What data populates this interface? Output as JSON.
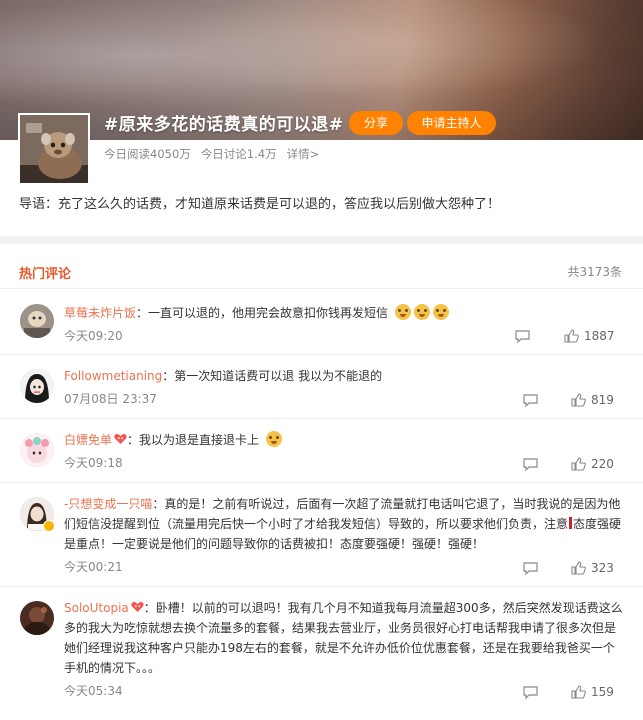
{
  "topic": {
    "title": "#原来多花的话费真的可以退#",
    "share_label": "分享",
    "apply_label": "申请主持人",
    "reads": "今日阅读4050万",
    "discussions": "今日讨论1.4万",
    "details_link": "详情>",
    "guide": "导语：充了这么久的话费，才知道原来话费是可以退的，答应我以后别做大怨种了！"
  },
  "hot_comments": {
    "heading": "热门评论",
    "total": "共3173条",
    "items": [
      {
        "user": "草莓未炸片饭",
        "text": "：一直可以退的，他用完会故意扣你钱再发短信",
        "emojis": [
          "crying-face",
          "crying-face",
          "crying-face"
        ],
        "time": "今天09:20",
        "likes": "1887"
      },
      {
        "user": "Followmetianing",
        "text": "：第一次知道话费可以退 我以为不能退的",
        "time": "07月08日 23:37",
        "likes": "819"
      },
      {
        "user": "白嫖免单",
        "text": "：我以为退是直接退卡上",
        "emojis": [
          "laughing-face"
        ],
        "time": "今天09:18",
        "likes": "220"
      },
      {
        "user": "-只想变成一只喵",
        "text_a": "：真的是！之前有听说过，后面有一次超了流量就打电话叫它退了，当时我说的是因为他们短信没提醒到位（流量用完后快一个小时了才给我发短信）导致的，所以要求他们负责，注意",
        "text_b": "态度强硬是重点！一定要说是他们的问题导致你的话费被扣！态度要强硬！强硬！强硬！",
        "time": "今天00:21",
        "likes": "323"
      },
      {
        "user": "SoloUtopia",
        "text": "：卧槽！以前的可以退吗！我有几个月不知道我每月流量超300多，然后突然发现话费这么多的我大为吃惊就想去换个流量多的套餐，结果我去营业厅，业务员很好心打电话帮我申请了很多次但是她们经理说我这种客户只能办198左右的套餐，就是不允许办低价位优惠套餐，还是在我要给我爸买一个手机的情况下。。。",
        "time": "今天05:34",
        "likes": "159"
      }
    ]
  },
  "colors": {
    "accent": "#ff8200",
    "username": "#eb7350",
    "section_heading": "#e55a2b"
  }
}
